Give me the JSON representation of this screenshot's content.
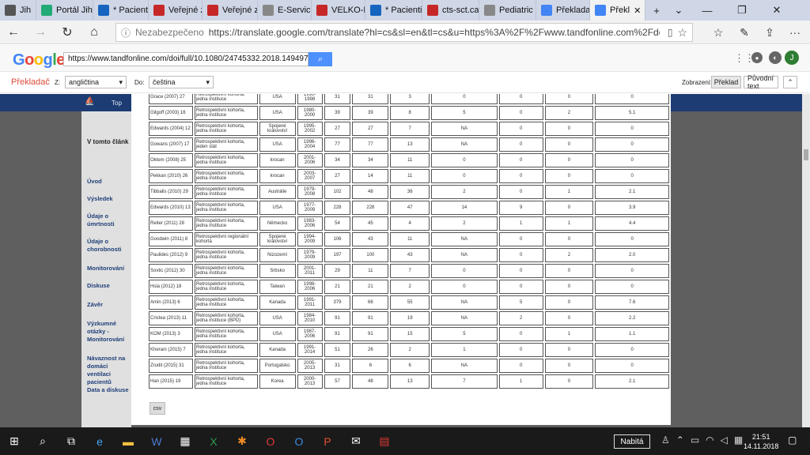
{
  "tabs": [
    {
      "label": "Jih",
      "icon": "back-arrow-icon",
      "c": "#555"
    },
    {
      "label": "Portál Jih",
      "icon": "image-icon",
      "c": "#2a7"
    },
    {
      "label": "* Pacienti",
      "icon": "trello-icon",
      "c": "#1565c0"
    },
    {
      "label": "Veřejné z",
      "icon": "circle-icon",
      "c": "#c62828"
    },
    {
      "label": "Veřejné z",
      "icon": "circle-icon",
      "c": "#c62828"
    },
    {
      "label": "E-Servicir",
      "icon": "doc-icon",
      "c": "#888"
    },
    {
      "label": "VELKO-PI",
      "icon": "doc-icon",
      "c": "#c62828"
    },
    {
      "label": "* Pacienti",
      "icon": "trello-icon",
      "c": "#1565c0"
    },
    {
      "label": "cts-sct.ca",
      "icon": "circle-icon",
      "c": "#c62828"
    },
    {
      "label": "Pediatric",
      "icon": "image-icon",
      "c": "#888"
    },
    {
      "label": "Překladac",
      "icon": "translate-icon",
      "c": "#4285f4"
    },
    {
      "label": "Překl",
      "icon": "translate-icon",
      "c": "#4285f4",
      "active": true
    }
  ],
  "address": {
    "prefix": "Nezabezpečeno",
    "url": "https://translate.google.com/translate?hl=cs&sl=en&tl=cs&u=https%3A%2F%2Fwww.tandfonline.com%2Fdoi%2Ffull%2F10.1080%2F2"
  },
  "google": {
    "logo": "Google",
    "input": "https://www.tandfonline.com/doi/full/10.1080/24745332.2018.1494978"
  },
  "translate_bar": {
    "title": "Překladač",
    "from_label": "Z:",
    "from_value": "angličtina",
    "to_label": "Do:",
    "to_value": "čeština",
    "view_label": "Zobrazení:",
    "btn_translation": "Překlad",
    "btn_original": "Původní text"
  },
  "site": {
    "top": "Top",
    "article_heading": "V tomto článk"
  },
  "nav": [
    "Úvod",
    "Výsledek",
    "Údaje o úmrtnosti",
    "Údaje o chorobnosti",
    "Monitorování",
    "Diskuse",
    "Závěr",
    "Výzkumné otázky - Monitorování",
    "Návaznost na domácí ventilaci pacientů",
    "Data a diskuse"
  ],
  "table": [
    [
      "Grace (2007) 27",
      "Retrospektivní kohorta, jedna instituce",
      "USA",
      "1996-1998",
      "31",
      "31",
      "3",
      "0",
      "0",
      "0",
      "0"
    ],
    [
      "Gilgoff (2003) 16",
      "Retrospektivní kohorta, jedna instituce",
      "USA",
      "1980-2000",
      "39",
      "39",
      "8",
      "5",
      "0",
      "2",
      "5.1"
    ],
    [
      "Edwards (2004) 12",
      "Retrospektivní kohorta, jedna instituce",
      "Spojené království",
      "1995-2002",
      "27",
      "27",
      "7",
      "NA",
      "0",
      "0",
      "0"
    ],
    [
      "Gowans (2007) 17",
      "Retrospektivní kohorta, jeden stát",
      "USA",
      "1996-2004",
      "77",
      "77",
      "13",
      "NA",
      "0",
      "0",
      "0"
    ],
    [
      "Oktem (2008) 25",
      "Retrospektivní kohorta, jedna instituce",
      "krocan",
      "2001-2006",
      "34",
      "34",
      "11",
      "0",
      "0",
      "0",
      "0"
    ],
    [
      "Pekkan (2010) 26",
      "Retrospektivní kohorta, jedna instituce",
      "krocan",
      "2003-2007",
      "27",
      "14",
      "11",
      "0",
      "0",
      "0",
      "0"
    ],
    [
      "Tibballs (2010) 29",
      "Retrospektivní kohorta, jedna instituce",
      "Austrálie",
      "1979-2008",
      "102",
      "48",
      "36",
      "2",
      "0",
      "1",
      "2.1"
    ],
    [
      "Edwards (2010) 13",
      "Retrospektivní kohorta, jedna instituce",
      "USA",
      "1977-2009",
      "228",
      "228",
      "47",
      "14",
      "9",
      "0",
      "3.9"
    ],
    [
      "Reiter (2011) 28",
      "Retrospektivní kohorta, jedna instituce",
      "Německo",
      "1983-2006",
      "54",
      "45",
      "4",
      "2",
      "1",
      "1",
      "4.4"
    ],
    [
      "Goodwin (2011) 8",
      "Retrospektivní regionální kohorta",
      "Spojené království",
      "1994-2009",
      "106",
      "43",
      "11",
      "NA",
      "0",
      "0",
      "0"
    ],
    [
      "Paulides (2012) 9",
      "Retrospektivní kohorta, jedna instituce",
      "Nizozemí",
      "1979-2009",
      "197",
      "100",
      "43",
      "NA",
      "0",
      "2",
      "2.0"
    ],
    [
      "Sovtic (2012) 30",
      "Retrospektivní kohorta, jedna instituce",
      "Srbsko",
      "2001-2011",
      "29",
      "11",
      "7",
      "0",
      "0",
      "0",
      "0"
    ],
    [
      "Hsia (2012) 18",
      "Retrospektivní kohorta, jedna instituce",
      "Taiwan",
      "1998-2006",
      "21",
      "21",
      "2",
      "0",
      "0",
      "0",
      "0"
    ],
    [
      "Amin (2013) 6",
      "Retrospektivní kohorta, jedna instituce",
      "Kanada",
      "1991-2011",
      "379",
      "66",
      "55",
      "NA",
      "5",
      "0",
      "7.6"
    ],
    [
      "Cristea (2013) 11",
      "Retrospektivní kohorta, jedna instituce (BPD)",
      "USA",
      "1984-2010",
      "91",
      "91",
      "19",
      "NA",
      "2",
      "0",
      "2.2"
    ],
    [
      "KOM (2013) 3",
      "Retrospektivní kohorta, jedna instituce",
      "USA",
      "1987-2006",
      "91",
      "91",
      "15",
      "5",
      "0",
      "1",
      "1.1"
    ],
    [
      "Kherani (2015) 7",
      "Retrospektivní kohorta, jedna instituce",
      "Kanada",
      "1991-2014",
      "51",
      "26",
      "2",
      "1",
      "0",
      "0",
      "0"
    ],
    [
      "Zrudit (2015) 31",
      "Retrospektivní kohorta, jedna instituce",
      "Portugalsko",
      "2005-2013",
      "31",
      "6",
      "6",
      "NA",
      "0",
      "0",
      "0"
    ],
    [
      "Han (2015) 19",
      "Retrospektivní kohorta, jedna instituce",
      "Korea",
      "2000-2013",
      "57",
      "48",
      "13",
      "7",
      "1",
      "0",
      "2.1"
    ]
  ],
  "csv": "csv",
  "taskbar": {
    "lang": "Nabitá",
    "time": "21:51",
    "date": "14.11.2018"
  },
  "user_initial": "J"
}
